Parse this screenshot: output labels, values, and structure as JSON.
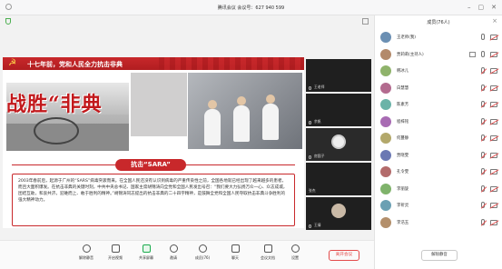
{
  "window": {
    "title": "腾讯会议 会议号：627 940 599"
  },
  "slide": {
    "header_title": "十七年前，党和人民全力抗击非典",
    "banner_text": "战胜“非典",
    "pill_label": "抗击“SARA”",
    "body": "2003年春前后，起源于广州的“SARS”病毒突袭而来。在全国人民还没有认识到病毒的严重传染性之前，全国各地就已经出现了越来越多的患者，而且大面积爆发。在抗击非典的关键时刻，中共中央总书记、国家主席胡锦涛向全党和全国人民发出号召：“我们要大力弘扬万众一心、众志成城，团结互助，和衷共济，迎难而上、敢于胜利的精神。”胡锦涛同志提出的抗击非典的二十四字精神，是鼓舞全党和全国人民夺取抗击非典斗争胜利的强大精神动力。"
  },
  "tiles": [
    {
      "name": "王老师"
    },
    {
      "name": "余帆"
    },
    {
      "name": "房囡子"
    },
    {
      "name": "张杰"
    },
    {
      "name": "王倩"
    }
  ],
  "toolbar": {
    "buttons": [
      {
        "label": "解除静音"
      },
      {
        "label": "开启视频"
      },
      {
        "label": "共享屏幕"
      },
      {
        "label": "邀请"
      },
      {
        "label": "成员(76)"
      },
      {
        "label": "聊天"
      },
      {
        "label": "会议文档"
      },
      {
        "label": "设置"
      }
    ],
    "leave_label": "离开会议"
  },
  "panel": {
    "title": "成员(76人)",
    "mute_all_label": "解除静音",
    "members": [
      {
        "name": "王老师(我)",
        "mic": "on",
        "cam": "on"
      },
      {
        "name": "贾莉莉(主持人)",
        "mic": "on",
        "cam": "on",
        "share": true
      },
      {
        "name": "韩冰儿",
        "mic": "muted",
        "cam": "off"
      },
      {
        "name": "白慧慧",
        "mic": "muted",
        "cam": "off"
      },
      {
        "name": "陈素芳",
        "mic": "muted",
        "cam": "off"
      },
      {
        "name": "程梓铭",
        "mic": "muted",
        "cam": "off"
      },
      {
        "name": "何蔓静",
        "mic": "muted",
        "cam": "off"
      },
      {
        "name": "贾晓雯",
        "mic": "muted",
        "cam": "off"
      },
      {
        "name": "孔令雯",
        "mic": "muted",
        "cam": "off"
      },
      {
        "name": "李丽旋",
        "mic": "muted",
        "cam": "off"
      },
      {
        "name": "李祈灵",
        "mic": "muted",
        "cam": "off"
      },
      {
        "name": "李浩玉",
        "mic": "muted",
        "cam": "off"
      }
    ]
  }
}
